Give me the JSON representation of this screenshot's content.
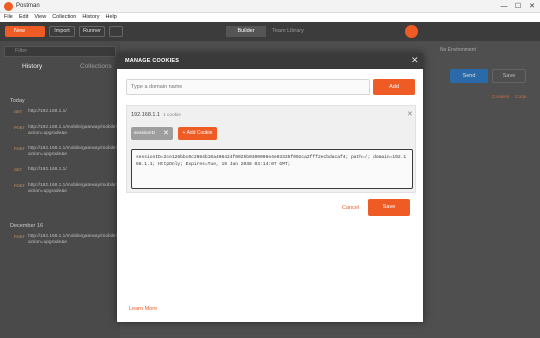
{
  "window": {
    "title": "Postman",
    "min": "—",
    "max": "☐",
    "close": "✕"
  },
  "menu": [
    "File",
    "Edit",
    "View",
    "Collection",
    "History",
    "Help"
  ],
  "toolbar": {
    "new_label": "New",
    "import_label": "Import",
    "runner_label": "Runner",
    "builder_tab": "Builder",
    "team_tab": "Team Library"
  },
  "left": {
    "filter_placeholder": "Filter",
    "tab_history": "History",
    "tab_collections": "Collections",
    "section_today": "Today",
    "section_dec": "December 16",
    "rows": [
      {
        "method": "GET",
        "url": "http://192.168.1.1/"
      },
      {
        "method": "POST",
        "url": "http://192.168.1.1/mobile/gateway/mobile?action=upgrade&e"
      },
      {
        "method": "POST",
        "url": "http://192.168.1.1/mobile/gateway/mobile?action=upgrade&e"
      },
      {
        "method": "GET",
        "url": "http://192.168.1.1/"
      },
      {
        "method": "POST",
        "url": "http://192.168.1.1/mobile/gateway/mobile?action=upgrade&e"
      },
      {
        "method": "POST",
        "url": "http://192.168.1.1/mobile/gateway/mobile?action=upgrade&e"
      }
    ]
  },
  "right": {
    "send_label": "Send",
    "save_label": "Save",
    "cookies_link": "Cookies",
    "code_link": "Code",
    "env": "No Environment"
  },
  "modal": {
    "title": "MANAGE COOKIES",
    "close": "✕",
    "domain_placeholder": "Type a domain name",
    "add_label": "Add",
    "domain": "192.168.1.1",
    "cookie_count": "1 cookie",
    "domain_close": "✕",
    "cookie_chip": "sessionID",
    "chip_close": "✕",
    "add_cookie_label": "+ Add Cookie",
    "cookie_value": "sessionID=2ce126bbc0c2084b10a408424f0025b0300006e4e03335f002ca2fff2ecbdacaf4; path=/; domain=192.168.1.1; HttpOnly; Expires=Tue, 19 Jan 2038 03:14:07 GMT;",
    "cancel_label": "Cancel",
    "save_label": "Save",
    "learn_more": "Learn More"
  },
  "colors": {
    "accent": "#ef5b25",
    "dark_header": "#3a3a3a"
  }
}
